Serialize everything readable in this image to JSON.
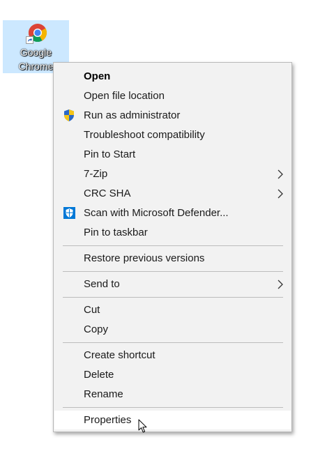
{
  "desktop": {
    "shortcut": {
      "label": "Google\nChrome",
      "icon": "chrome-icon",
      "selected": true
    }
  },
  "context_menu": {
    "items": [
      {
        "label": "Open",
        "bold": true
      },
      {
        "label": "Open file location"
      },
      {
        "label": "Run as administrator",
        "icon": "uac-shield-icon"
      },
      {
        "label": "Troubleshoot compatibility"
      },
      {
        "label": "Pin to Start"
      },
      {
        "label": "7-Zip",
        "submenu": true
      },
      {
        "label": "CRC SHA",
        "submenu": true
      },
      {
        "label": "Scan with Microsoft Defender...",
        "icon": "defender-icon"
      },
      {
        "label": "Pin to taskbar"
      },
      {
        "label": "Restore previous versions"
      },
      {
        "label": "Send to",
        "submenu": true
      },
      {
        "label": "Cut"
      },
      {
        "label": "Copy"
      },
      {
        "label": "Create shortcut"
      },
      {
        "label": "Delete"
      },
      {
        "label": "Rename"
      },
      {
        "label": "Properties",
        "hovered": true
      }
    ]
  },
  "colors": {
    "menu_background": "#f2f2f2",
    "hover_background": "#ffffff",
    "selection_background": "#cce8ff",
    "separator": "#bcbcbc",
    "shield_blue": "#2a68c8",
    "shield_yellow": "#f5c518",
    "defender_blue": "#0078d7"
  }
}
